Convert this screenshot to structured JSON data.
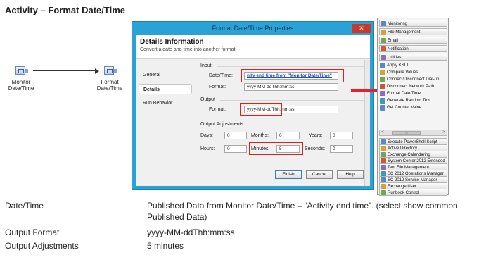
{
  "page": {
    "title": "Activity – Format Date/Time"
  },
  "workflow": {
    "nodes": [
      {
        "label": "Monitor Date/Time"
      },
      {
        "label": "Format Date/Time"
      }
    ]
  },
  "dialog": {
    "title": "Format Date/Time Properties",
    "close_label": "✕",
    "header": "Details Information",
    "subheader": "Convert a date and time into another format",
    "nav": [
      "General",
      "Details",
      "Run Behavior"
    ],
    "input": {
      "group_label": "Input",
      "datetime_label": "Date/Time:",
      "datetime_value": "nity end time from \"Monitor Date/Time\"",
      "format_label": "Format:",
      "format_value": "yyyy-MM-ddThh:mm:ss"
    },
    "output": {
      "group_label": "Output",
      "format_label": "Format:",
      "format_value": "yyyy-MM-ddThh:mm:ss"
    },
    "adjustments": {
      "group_label": "Output Adjustments",
      "days_label": "Days:",
      "days_value": "0",
      "months_label": "Months:",
      "months_value": "0",
      "years_label": "Years:",
      "years_value": "0",
      "hours_label": "Hours:",
      "hours_value": "0",
      "minutes_label": "Minutes:",
      "minutes_value": "5",
      "seconds_label": "Seconds:",
      "seconds_value": "0"
    },
    "buttons": {
      "finish": "Finish",
      "cancel": "Cancel",
      "help": "Help"
    }
  },
  "activities_panel": {
    "categories_top": [
      "Monitoring",
      "File Management",
      "Email",
      "Notification",
      "Utilities"
    ],
    "utilities_items": [
      "Apply XSLT",
      "Compare Values",
      "Connect/Disconnect Dial-up",
      "Disconnect Network Path",
      "Format Date/Time",
      "Generate Random Text",
      "Get Counter Value"
    ],
    "scroll": {
      "left": "<",
      "right": ">",
      "thumb": "III"
    },
    "categories_bottom": [
      "Execute PowerShell Script",
      "Active Directory",
      "Exchange Calendaring",
      "System Center 2012 Extended",
      "Text File Management",
      "SC 2012 Operations Manager",
      "SC 2012 Service Manager",
      "Exchange User",
      "Runbook Control"
    ]
  },
  "properties": [
    {
      "key": "Date/Time",
      "value": "Published Data from Monitor Date/Time – “Activity end time”. (select show common Published Data)"
    },
    {
      "key": "Output Format",
      "value": "yyyy-MM-ddThh:mm:ss"
    },
    {
      "key": "Output Adjustments",
      "value": "5 minutes"
    }
  ],
  "colors": {
    "dialog_frame": "#2aa2d6",
    "highlight_red": "#e01f1f",
    "link_blue": "#1d4fb8"
  },
  "icons": [
    "activity-node-icon",
    "close-icon",
    "category-icon",
    "activity-icon"
  ]
}
